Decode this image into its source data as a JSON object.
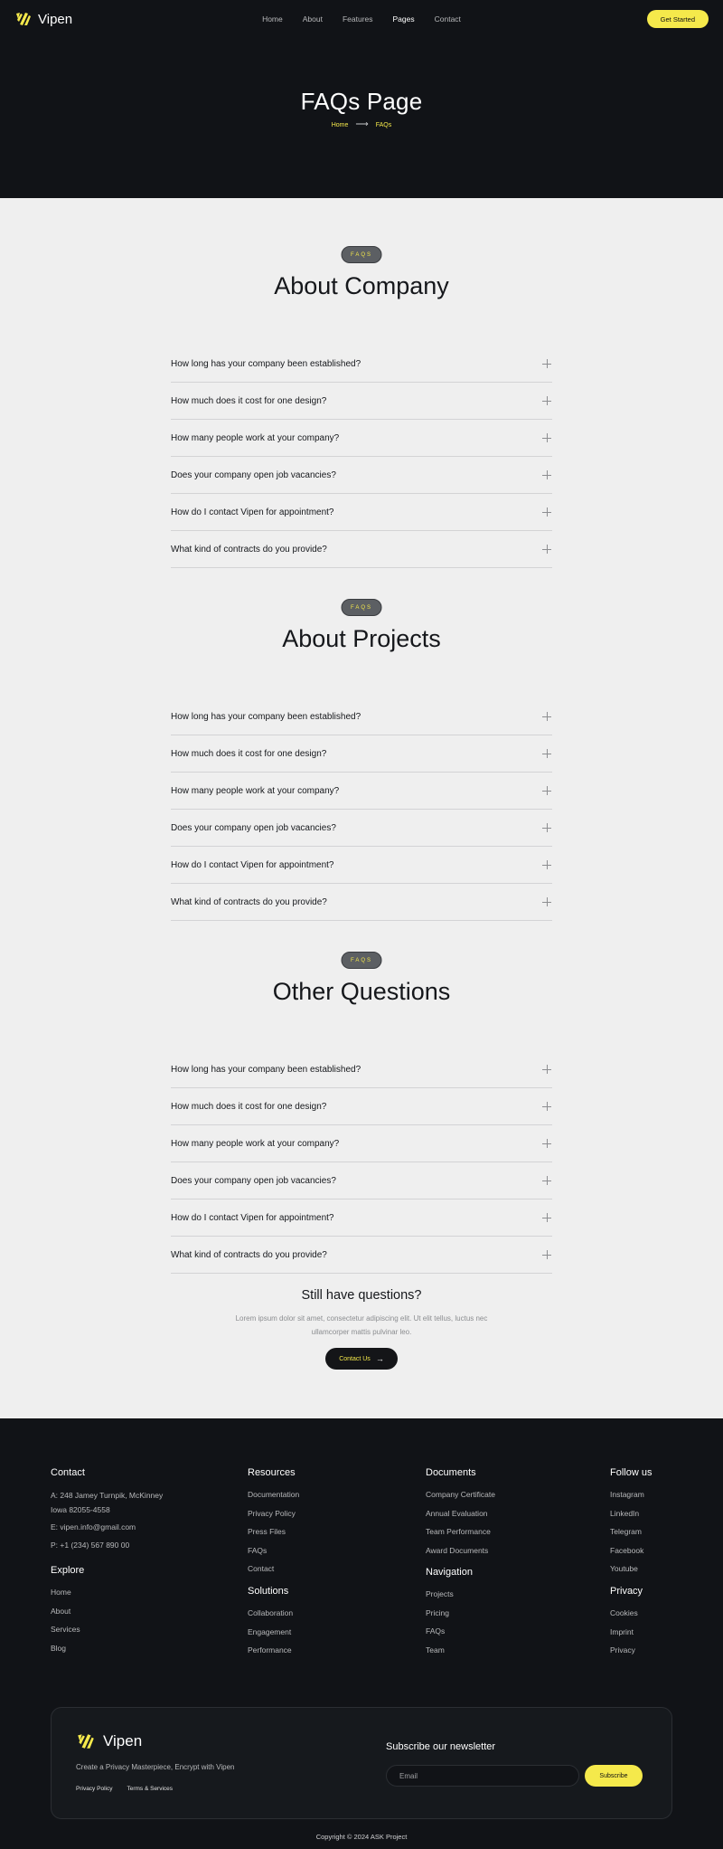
{
  "brand": {
    "name": "Vipen"
  },
  "nav": {
    "links": [
      "Home",
      "About",
      "Features",
      "Pages",
      "Contact"
    ],
    "active": "Pages",
    "cta": "Get Started"
  },
  "hero": {
    "title": "FAQs Page",
    "breadcrumb": [
      "Home",
      "FAQs"
    ]
  },
  "sections": [
    {
      "badge": "FAQS",
      "title": "About Company",
      "questions": [
        "How long has your company been established?",
        "How much does it cost for one design?",
        "How many people work at your company?",
        "Does your company open job vacancies?",
        "How do I contact Vipen for appointment?",
        "What kind of contracts do you provide?"
      ]
    },
    {
      "badge": "FAQS",
      "title": "About Projects",
      "questions": [
        "How long has your company been established?",
        "How much does it cost for one design?",
        "How many people work at your company?",
        "Does your company open job vacancies?",
        "How do I contact Vipen for appointment?",
        "What kind of contracts do you provide?"
      ]
    },
    {
      "badge": "FAQS",
      "title": "Other Questions",
      "questions": [
        "How long has your company been established?",
        "How much does it cost for one design?",
        "How many people work at your company?",
        "Does your company open job vacancies?",
        "How do I contact Vipen for appointment?",
        "What kind of contracts do you provide?"
      ]
    }
  ],
  "still": {
    "title": "Still have questions?",
    "text": "Lorem ipsum dolor sit amet, consectetur adipiscing elit. Ut elit tellus, luctus nec ullamcorper mattis pulvinar leo.",
    "button": "Contact Us"
  },
  "footer": {
    "contact": {
      "title": "Contact",
      "address": "A: 248 Jamey Turnpik, McKinney Iowa 82055-4558",
      "email": "E: vipen.info@gmail.com",
      "phone": "P: +1 (234) 567 890 00"
    },
    "explore": {
      "title": "Explore",
      "links": [
        "Home",
        "About",
        "Services",
        "Blog"
      ]
    },
    "resources": {
      "title": "Resources",
      "links": [
        "Documentation",
        "Privacy Policy",
        "Press Files",
        "FAQs",
        "Contact"
      ]
    },
    "solutions": {
      "title": "Solutions",
      "links": [
        "Collaboration",
        "Engagement",
        "Performance"
      ]
    },
    "documents": {
      "title": "Documents",
      "links": [
        "Company Certificate",
        "Annual Evaluation",
        "Team Performance",
        "Award Documents"
      ]
    },
    "navigation": {
      "title": "Navigation",
      "links": [
        "Projects",
        "Pricing",
        "FAQs",
        "Team"
      ]
    },
    "follow": {
      "title": "Follow us",
      "links": [
        "Instagram",
        "LinkedIn",
        "Telegram",
        "Facebook",
        "Youtube"
      ]
    },
    "privacy": {
      "title": "Privacy",
      "links": [
        "Cookies",
        "Imprint",
        "Privacy"
      ]
    },
    "newsletter": {
      "tagline": "Create a Privacy Masterpiece, Encrypt with Vipen",
      "links": [
        "Privacy Policy",
        "Terms & Services"
      ],
      "title": "Subscribe our newsletter",
      "placeholder": "Email",
      "button": "Subscribe"
    },
    "copyright": "Copyright © 2024 ASK Project"
  },
  "colors": {
    "accent": "#f5e94b",
    "dark": "#111317",
    "light": "#efefef"
  }
}
